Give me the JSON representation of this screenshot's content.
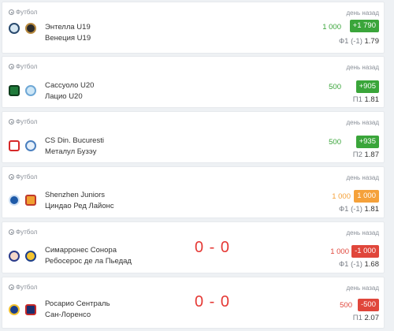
{
  "matches": [
    {
      "sport": "Футбол",
      "time": "день назад",
      "team1": "Энтелла U19",
      "team2": "Венеция U19",
      "score": "",
      "stake": "1 000",
      "result": "+1 790",
      "market": "Ф1 (-1)",
      "odds": "1.79",
      "status": "win",
      "logo1_icon": "entella-crest-icon",
      "logo2_icon": "venezia-crest-icon"
    },
    {
      "sport": "Футбол",
      "time": "день назад",
      "team1": "Сассуоло U20",
      "team2": "Лацио U20",
      "score": "",
      "stake": "500",
      "result": "+905",
      "market": "П1",
      "odds": "1.81",
      "status": "win",
      "logo1_icon": "sassuolo-crest-icon",
      "logo2_icon": "lazio-eagle-icon"
    },
    {
      "sport": "Футбол",
      "time": "день назад",
      "team1": "CS Din. Bucuresti",
      "team2": "Металул Бузэу",
      "score": "",
      "stake": "500",
      "result": "+935",
      "market": "П2",
      "odds": "1.87",
      "status": "win",
      "logo1_icon": "dinamo-crest-icon",
      "logo2_icon": "metalul-crest-icon"
    },
    {
      "sport": "Футбол",
      "time": "день назад",
      "team1": "Shenzhen Juniors",
      "team2": "Циндао Ред Лайонс",
      "score": "",
      "stake": "1 000",
      "result": "1 000",
      "market": "Ф1 (-1)",
      "odds": "1.81",
      "status": "refund",
      "logo1_icon": "shenzhen-crest-icon",
      "logo2_icon": "qingdao-crest-icon"
    },
    {
      "sport": "Футбол",
      "time": "день назад",
      "team1": "Симарронес Сонора",
      "team2": "Ребосерос де ла Пьедад",
      "score": "0 - 0",
      "stake": "1 000",
      "result": "-1 000",
      "market": "Ф1 (-1)",
      "odds": "1.68",
      "status": "loss",
      "logo1_icon": "cimarrones-crest-icon",
      "logo2_icon": "reboceros-crest-icon"
    },
    {
      "sport": "Футбол",
      "time": "день назад",
      "team1": "Росарио Сентраль",
      "team2": "Сан-Лоренсо",
      "score": "0 - 0",
      "stake": "500",
      "result": "-500",
      "market": "П1",
      "odds": "2.07",
      "status": "loss",
      "logo1_icon": "rosario-central-crest-icon",
      "logo2_icon": "san-lorenzo-crest-icon"
    }
  ],
  "colors": {
    "win": "#3aa53a",
    "loss": "#e0463b",
    "refund": "#f5a13a",
    "score": "#e53935"
  }
}
